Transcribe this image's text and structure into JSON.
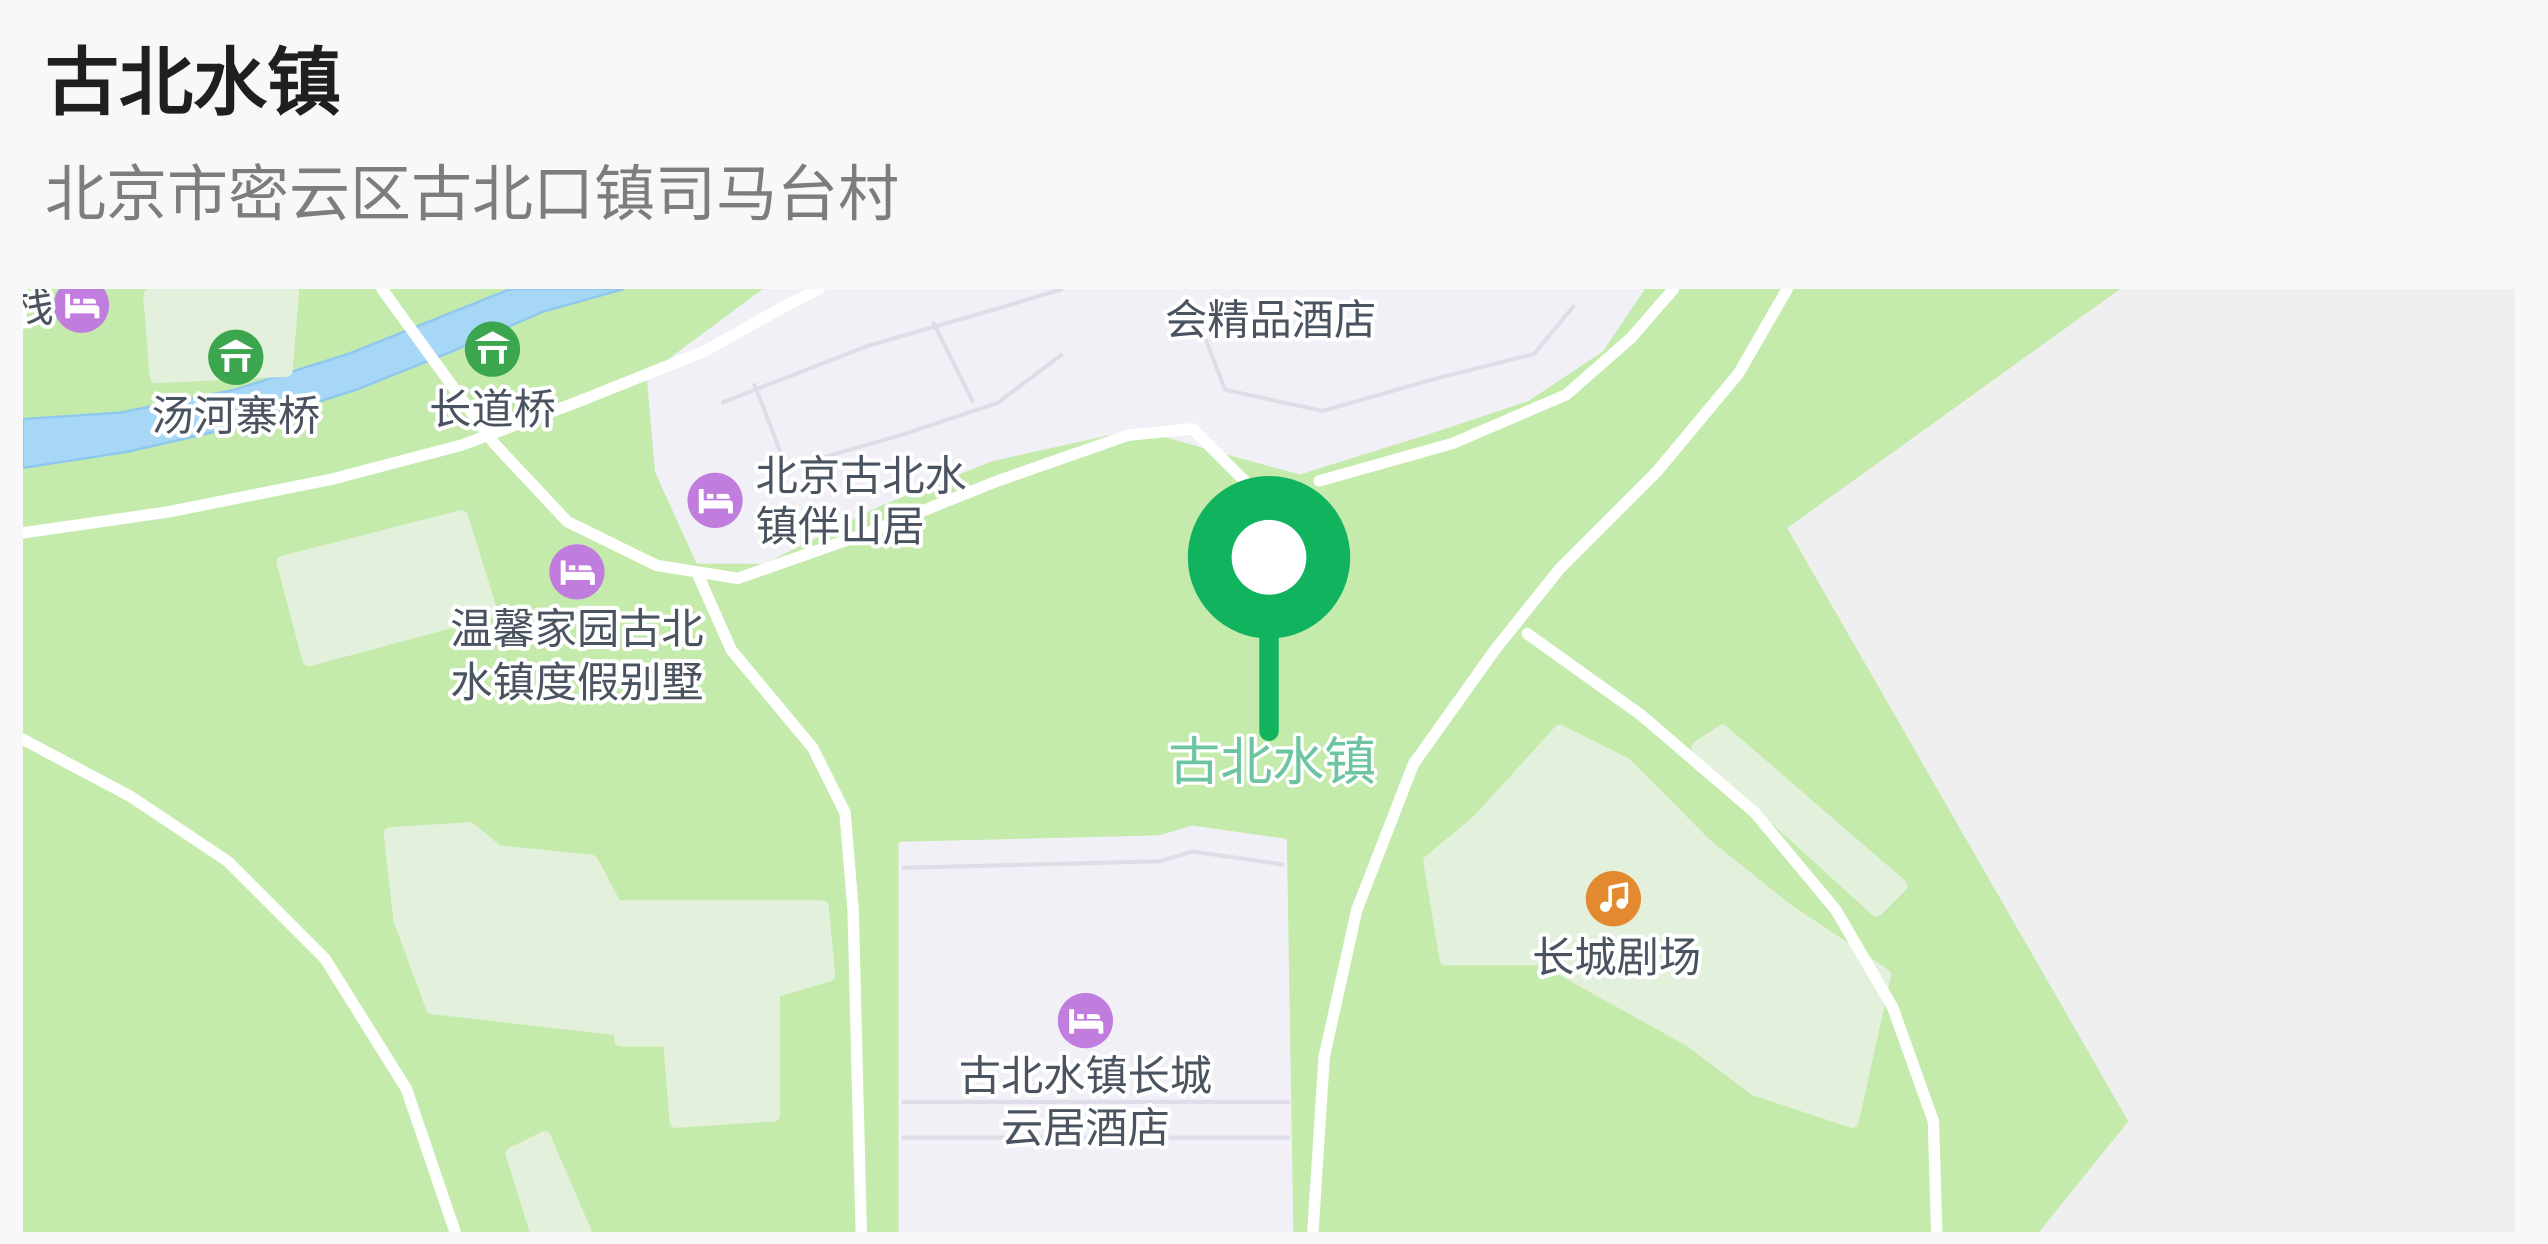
{
  "place": {
    "name": "古北水镇",
    "address": "北京市密云区古北口镇司马台村"
  },
  "map": {
    "marker": {
      "label": "古北水镇",
      "icon": "location-pin-icon"
    },
    "pois": [
      {
        "icon": "hotel-icon",
        "lines": [
          "栈"
        ]
      },
      {
        "icon": "scenic-spot-icon",
        "lines": [
          "汤河寨桥"
        ]
      },
      {
        "icon": "scenic-spot-icon",
        "lines": [
          "长道桥"
        ]
      },
      {
        "icon": "hotel-icon",
        "lines": [
          "北京古北水",
          "镇伴山居"
        ]
      },
      {
        "lines": [
          "会精品酒店"
        ]
      },
      {
        "icon": "hotel-icon",
        "lines": [
          "温馨家园古北",
          "水镇度假别墅"
        ]
      },
      {
        "icon": "music-icon",
        "lines": [
          "长城剧场"
        ]
      },
      {
        "icon": "hotel-icon",
        "lines": [
          "古北水镇长城",
          "云居酒店"
        ]
      }
    ],
    "colors": {
      "land": "#c4ebab",
      "water": "#a6d7f6",
      "marker": "#12b35e",
      "marker_label": "#6cc4a1",
      "hotel_icon": "#c17ddd",
      "scenic_icon": "#3ba64d",
      "music_icon": "#e3892f"
    }
  }
}
